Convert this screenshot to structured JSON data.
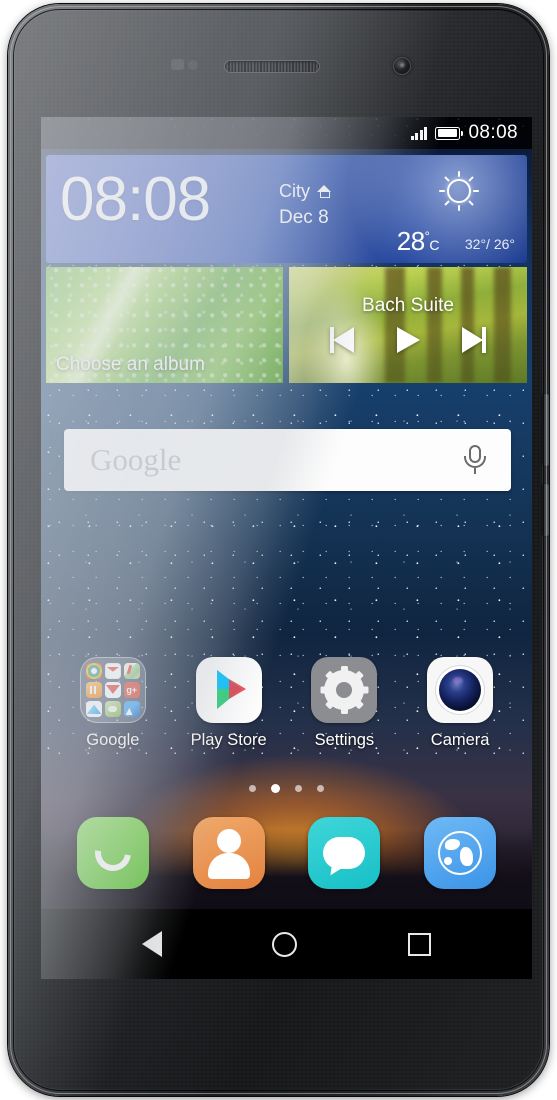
{
  "device": {
    "name": "smartphone",
    "hardware": {
      "earpiece": "earpiece-speaker",
      "front_camera": "front-camera-icon",
      "proximity_sensor": "proximity-sensor",
      "volume_button": "volume-button",
      "power_button": "power-button"
    }
  },
  "status_bar": {
    "signal_icon": "signal-bars-icon",
    "battery_icon": "battery-full-icon",
    "clock": "08:08"
  },
  "clock_widget": {
    "time": "08:08",
    "city": "City",
    "home_icon": "home-icon",
    "date": "Dec 8",
    "weather_icon": "sun-icon",
    "temperature": "28",
    "temperature_degree": "°",
    "temperature_unit": "C",
    "temp_range": "32°/ 26°",
    "background_color": "#2a50b4"
  },
  "gallery_widget": {
    "label": "Choose an album",
    "image": "green-leaf-waterdrops"
  },
  "music_widget": {
    "track_title": "Bach Suite",
    "image": "sunlit-tree-path",
    "controls": [
      {
        "name": "prev-track-button",
        "label": "Previous"
      },
      {
        "name": "play-button",
        "label": "Play"
      },
      {
        "name": "next-track-button",
        "label": "Next"
      }
    ]
  },
  "search": {
    "placeholder": "Google",
    "mic_icon": "microphone-icon"
  },
  "apps": [
    {
      "name": "google-folder",
      "label": "Google",
      "type": "folder",
      "mini_icons": [
        "chrome-icon",
        "gmail-icon",
        "maps-icon",
        "play-music-icon",
        "youtube-icon",
        "google-plus-icon",
        "drive-icon",
        "play-games-icon",
        "photos-icon"
      ]
    },
    {
      "name": "play-store",
      "label": "Play Store",
      "type": "app",
      "icon": "play-store-icon"
    },
    {
      "name": "settings",
      "label": "Settings",
      "type": "app",
      "icon": "gear-icon"
    },
    {
      "name": "camera",
      "label": "Camera",
      "type": "app",
      "icon": "camera-icon"
    }
  ],
  "page_indicator": {
    "total": 4,
    "active_index": 1
  },
  "dock": [
    {
      "name": "dock-phone",
      "label": "Phone",
      "icon": "handset-icon",
      "color": "#66c93f"
    },
    {
      "name": "dock-contacts",
      "label": "Contacts",
      "icon": "person-icon",
      "color": "#e4823f"
    },
    {
      "name": "dock-messages",
      "label": "Messages",
      "icon": "speech-bubble-icon",
      "color": "#16c0c6"
    },
    {
      "name": "dock-browser",
      "label": "Browser",
      "icon": "globe-icon",
      "color": "#3b94e8"
    }
  ],
  "nav_bar": [
    {
      "name": "nav-back-button",
      "icon": "back-triangle-icon"
    },
    {
      "name": "nav-home-button",
      "icon": "home-circle-icon"
    },
    {
      "name": "nav-recents-button",
      "icon": "recents-square-icon"
    }
  ],
  "wallpaper": {
    "description": "starry-night-sky-with-sunset-horizon"
  }
}
